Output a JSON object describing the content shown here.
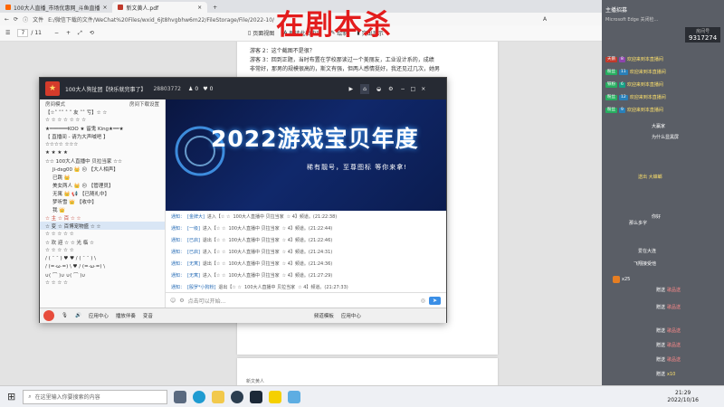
{
  "browser": {
    "tabs": [
      {
        "label": "100大人直播_市场优惠网_斗鱼直播"
      },
      {
        "label": "×"
      },
      {
        "label": "新文黄人.pdf",
        "active": true
      },
      {
        "label": "×"
      }
    ],
    "new_tab": "+",
    "address_label": "文件",
    "address": "E:/微信下载的文件/WeChat%20Files/wxid_6jt8hvgbhw6m22/FileStorage/File/2022-10/",
    "address_end": "A"
  },
  "pdf_toolbar": {
    "page_current": "7",
    "page_total": "/ 11",
    "tools": [
      "页面视图",
      "朗读此页内容",
      "绘制",
      "突出显示"
    ]
  },
  "watermark": "在剧本杀",
  "document": {
    "page1_lines": [
      "游客 2：这个截图不是很？",
      "游客 3：回到正题，当时布置在学校那读过一个美丽友，工业设计系的，成绩",
      "非常好，那男的规模很高的，斯文有强，但两人感情挺好，我还见过几次，她男"
    ],
    "page2_header": "新文黄人"
  },
  "client": {
    "title": "100大人狗扯团【快乐就完事了】",
    "id": "28803772",
    "likes": "0",
    "fans": "0",
    "left_header_a": "房间模式",
    "left_header_b": "房间下载设置",
    "list_rows": [
      "【☆˚ ˚˚ ˚ ˚ 友 ˚˚ 亏】☆ ☆",
      "☆ ☆ ☆ ☆ ☆ ☆ ☆",
      "★══════KOO ★ 留鬼 King★══★",
      "【 直播间 - 请为大声喊吧 】",
      "☆☆☆☆ ☆☆☆",
      "★ ★ ★ ★",
      "☆☆ 100大人直播中 贝拉当家 ☆☆",
      "Ji-dsg00 👑 😐 【大人相声】",
      "已跳 👑",
      "美女两人 👑 😐 【管理员】",
      "无寓 👑 📢 【已随礼中】",
      "梦听雪 👑 【收中】",
      "我 👑",
      "☆ 主 ☆ 百 ☆ ☆",
      "☆ 变 ☆ 百博宠物盛 ☆ ☆",
      "☆ ☆ ☆ ☆ ☆",
      "☆ 欢 迎 ☆ ☆ 光 临 ☆",
      "☆ ☆ ☆ ☆ ☆",
      "/ ( ¯ ¯ ) ♥ ♥ / ( ¯ ¯ ) \\",
      "/ (=·ω·=) \\ ♥ / (=·ω·=) \\",
      "∪( ⌒ )∪ ∪( ⌒ )∪",
      "☆ ☆ ☆ ☆"
    ],
    "banner_title": "2022游戏宝贝年度",
    "banner_sub": "稀有靓号，至尊图标 等你来拿!",
    "chat_rows": [
      {
        "prefix": "通知：",
        "user": "[金牌大]",
        "act": "进入【☆ ☆",
        "room": "100大人直播中 贝拉当家",
        "end": "☆ 4】频道。(21:22:38)"
      },
      {
        "prefix": "通知：",
        "user": "[一级]",
        "act": "进入【☆ ☆",
        "room": "100大人直播中 贝拉当家",
        "end": "☆ 4】频道。(21:22:44)"
      },
      {
        "prefix": "通知：",
        "user": "[已启]",
        "act": "退出【☆ ☆",
        "room": "100大人直播中 贝拉当家",
        "end": "☆ 4】频道。(21:22:46)"
      },
      {
        "prefix": "通知：",
        "user": "[已启]",
        "act": "进入【☆ ☆",
        "room": "100大人直播中 贝拉当家",
        "end": "☆ 4】频道。(21:24:31)"
      },
      {
        "prefix": "通知：",
        "user": "[无寓]",
        "act": "退出【☆ ☆",
        "room": "100大人直播中 贝拉当家",
        "end": "☆ 4】频道。(21:24:36)"
      },
      {
        "prefix": "通知：",
        "user": "[无寓]",
        "act": "进入【☆ ☆",
        "room": "100大人直播中 贝拉当家",
        "end": "☆ 4】频道。(21:27:29)"
      },
      {
        "prefix": "通知：",
        "user": "[殷罗*小狗粉]",
        "act": "退出【☆ ☆",
        "room": "100大人直播中 贝拉当家",
        "end": "☆ 4】频道。(21:27:33)"
      }
    ],
    "input_placeholder": "点击可以开始...",
    "bottom_items": [
      "应用中心",
      "播放伴奏",
      "变音"
    ],
    "bottom_right": [
      "频道模板",
      "应用中心"
    ]
  },
  "danmaku": {
    "header_title": "主播招募",
    "header_sub": "Microsoft Edge 关闭检...",
    "uid_label": "房间号",
    "uid": "9317274",
    "messages": [
      {
        "badge": "天鹅",
        "level": "8",
        "name": "",
        "text": "欢迎来到本直播间"
      },
      {
        "badge": "粉丝",
        "level": "11",
        "name": "",
        "text": "欢迎来到本直播间"
      },
      {
        "badge": "铁粉",
        "level": "6",
        "name": "",
        "text": "欢迎来到本直播间"
      },
      {
        "badge": "粉丝",
        "level": "12",
        "name": "",
        "text": "欢迎来到本直播间"
      },
      {
        "badge": "粉丝",
        "level": "9",
        "name": "",
        "text": "欢迎来到本直播间"
      },
      {
        "badge": "",
        "level": "",
        "name": "大赢家",
        "text": ""
      },
      {
        "badge": "",
        "level": "",
        "name": "为什么显黑屏",
        "text": ""
      },
      {
        "badge": "",
        "level": "",
        "name": "",
        "text": "送出 大蟑螂"
      },
      {
        "badge": "",
        "level": "",
        "name": "",
        "text": "你好"
      },
      {
        "badge": "",
        "level": "",
        "name": "那么多字",
        "text": ""
      },
      {
        "badge": "",
        "level": "",
        "name": "爱在大连",
        "text": ""
      },
      {
        "badge": "",
        "level": "",
        "name": "飞翔接受他",
        "text": ""
      },
      {
        "badge": "",
        "level": "",
        "name": "",
        "text": "x25"
      },
      {
        "badge": "",
        "level": "",
        "name": "赠送",
        "text": "歌品送"
      },
      {
        "badge": "",
        "level": "",
        "name": "赠送",
        "text": "歌品送"
      },
      {
        "badge": "",
        "level": "",
        "name": "赠送",
        "text": "歌品送"
      },
      {
        "badge": "",
        "level": "",
        "name": "赠送",
        "text": "歌品送"
      },
      {
        "badge": "",
        "level": "",
        "name": "赠送",
        "text": "歌品送"
      },
      {
        "badge": "",
        "level": "",
        "name": "赠送",
        "text": "x10"
      }
    ]
  },
  "taskbar": {
    "search_placeholder": "在这里输入你要搜索的内容",
    "time": "21:29",
    "date": "2022/10/16"
  },
  "colors": {
    "watermark": "#e31c1c",
    "client_top": "#262a33",
    "banner": "#10286b",
    "right_panel": "#5a5e66",
    "danmaku_text": "#ffe26b"
  }
}
